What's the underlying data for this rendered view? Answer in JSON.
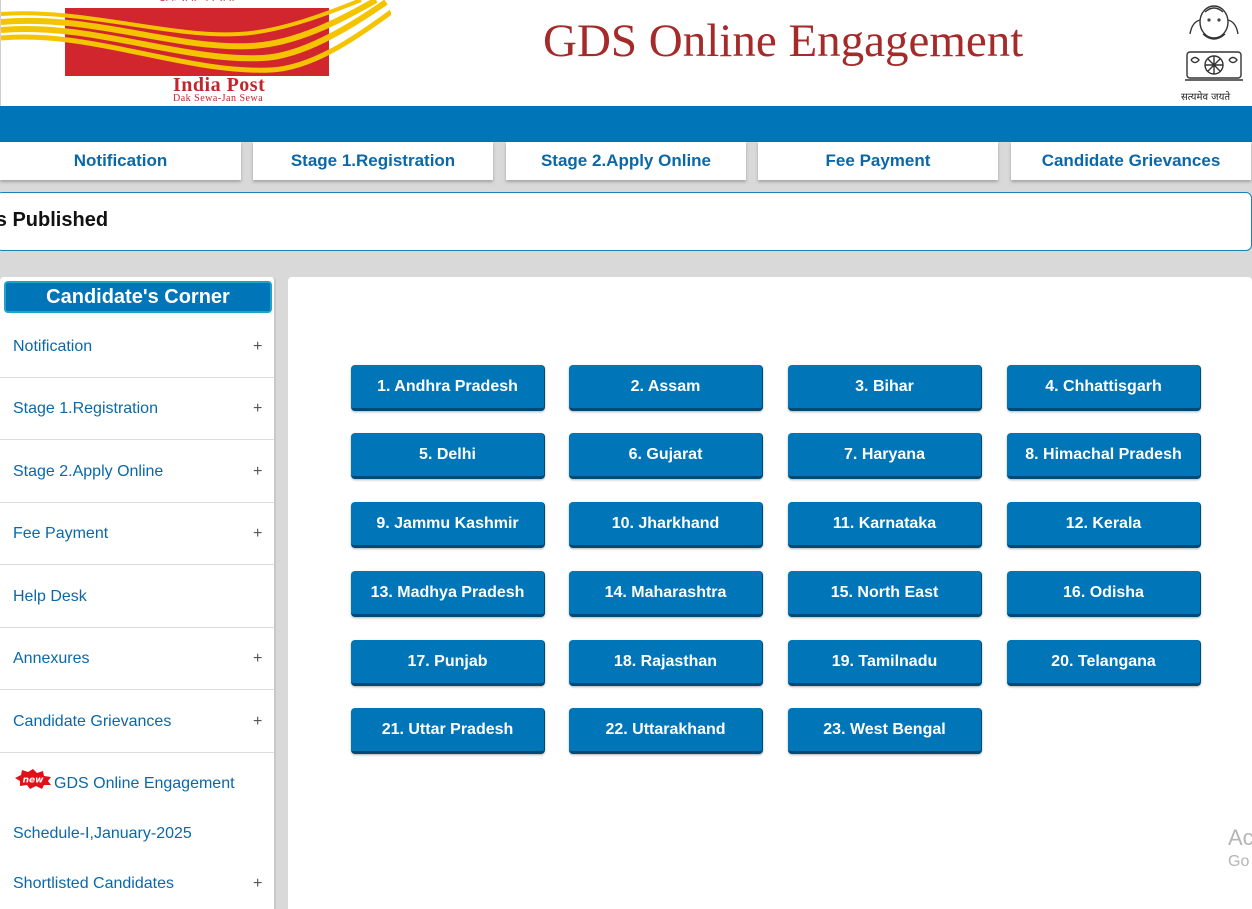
{
  "header": {
    "logo_top_text": "डाक सेवा-जन सेवा",
    "logo_name": "India Post",
    "logo_tagline": "Dak Sewa-Jan Sewa",
    "title": "GDS Online Engagement",
    "emblem_motto": "सत्यमेव जयते",
    "colors": {
      "brand_red": "#d1262e",
      "title": "#a52a2a",
      "blue": "#0075b8"
    }
  },
  "top_nav": [
    {
      "label": "Notification"
    },
    {
      "label": "Stage 1.Registration"
    },
    {
      "label": "Stage 2.Apply Online"
    },
    {
      "label": "Fee Payment"
    },
    {
      "label": "Candidate Grievances"
    }
  ],
  "marquee": {
    "text": "tes Published"
  },
  "sidebar": {
    "heading": "Candidate's Corner",
    "items": [
      {
        "label": "Notification",
        "expander": "+"
      },
      {
        "label": "Stage 1.Registration",
        "expander": "+"
      },
      {
        "label": "Stage 2.Apply Online",
        "expander": "+"
      },
      {
        "label": "Fee Payment",
        "expander": "+"
      },
      {
        "label": "Help Desk",
        "expander": ""
      },
      {
        "label": "Annexures",
        "expander": "+"
      },
      {
        "label": "Candidate Grievances",
        "expander": "+"
      }
    ],
    "new_badge": "new",
    "announcement": "GDS Online Engagement",
    "schedule": "Schedule-I,January-2025",
    "shortlisted": {
      "label": "Shortlisted Candidates",
      "expander": "+"
    }
  },
  "circles": [
    "1. Andhra Pradesh",
    "2. Assam",
    "3. Bihar",
    "4. Chhattisgarh",
    "5. Delhi",
    "6. Gujarat",
    "7. Haryana",
    "8. Himachal Pradesh",
    "9. Jammu Kashmir",
    "10. Jharkhand",
    "11. Karnataka",
    "12. Kerala",
    "13. Madhya Pradesh",
    "14. Maharashtra",
    "15. North East",
    "16. Odisha",
    "17. Punjab",
    "18. Rajasthan",
    "19. Tamilnadu",
    "20. Telangana",
    "21. Uttar Pradesh",
    "22. Uttarakhand",
    "23. West Bengal"
  ],
  "watermark": {
    "line1": "Ac",
    "line2": "Go"
  }
}
